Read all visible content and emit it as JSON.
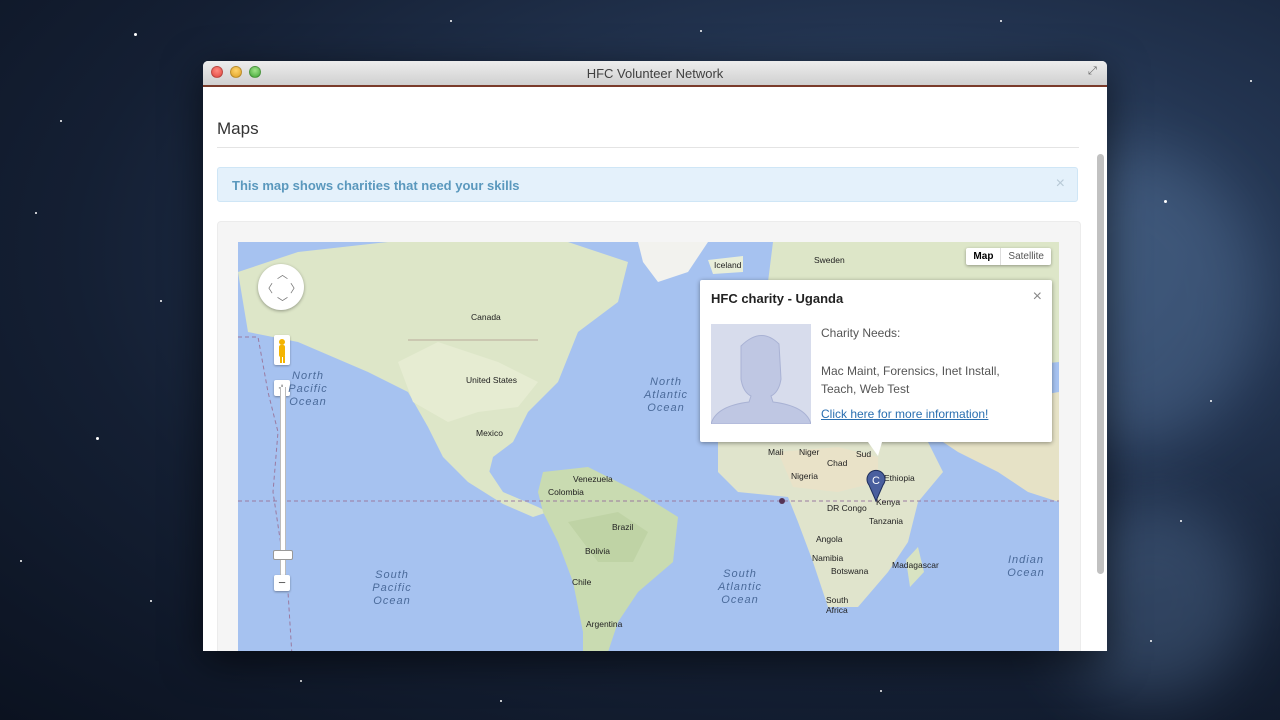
{
  "window": {
    "title": "HFC Volunteer Network"
  },
  "page": {
    "title": "Maps"
  },
  "alert": {
    "text": "This map shows charities that need your skills",
    "close": "×"
  },
  "map": {
    "type_controls": [
      "Map",
      "Satellite"
    ],
    "zoom_in": "+",
    "zoom_out": "−",
    "labels": {
      "iceland": "Iceland",
      "sweden": "Sweden",
      "canada": "Canada",
      "united_states": "United States",
      "mexico": "Mexico",
      "venezuela": "Venezuela",
      "colombia": "Colombia",
      "brazil": "Brazil",
      "bolivia": "Bolivia",
      "chile": "Chile",
      "argentina": "Argentina",
      "mali": "Mali",
      "niger": "Niger",
      "chad": "Chad",
      "sudan": "Sud",
      "ethiopia": "Ethiopia",
      "nigeria": "Nigeria",
      "kenya": "Kenya",
      "dr_congo": "DR Congo",
      "tanzania": "Tanzania",
      "angola": "Angola",
      "namibia": "Namibia",
      "botswana": "Botswana",
      "madagascar": "Madagascar",
      "south_africa": "South Africa"
    },
    "oceans": {
      "north_pacific": "North Pacific Ocean",
      "north_atlantic": "North Atlantic Ocean",
      "south_pacific": "South Pacific Ocean",
      "south_atlantic": "South Atlantic Ocean",
      "indian": "Indian Ocean"
    },
    "marker_label": "C"
  },
  "infowindow": {
    "title": "HFC charity - Uganda",
    "close": "×",
    "needs_label": "Charity Needs:",
    "needs_list": "Mac Maint, Forensics, Inet Install, Teach, Web Test",
    "link": "Click here for more information!"
  }
}
